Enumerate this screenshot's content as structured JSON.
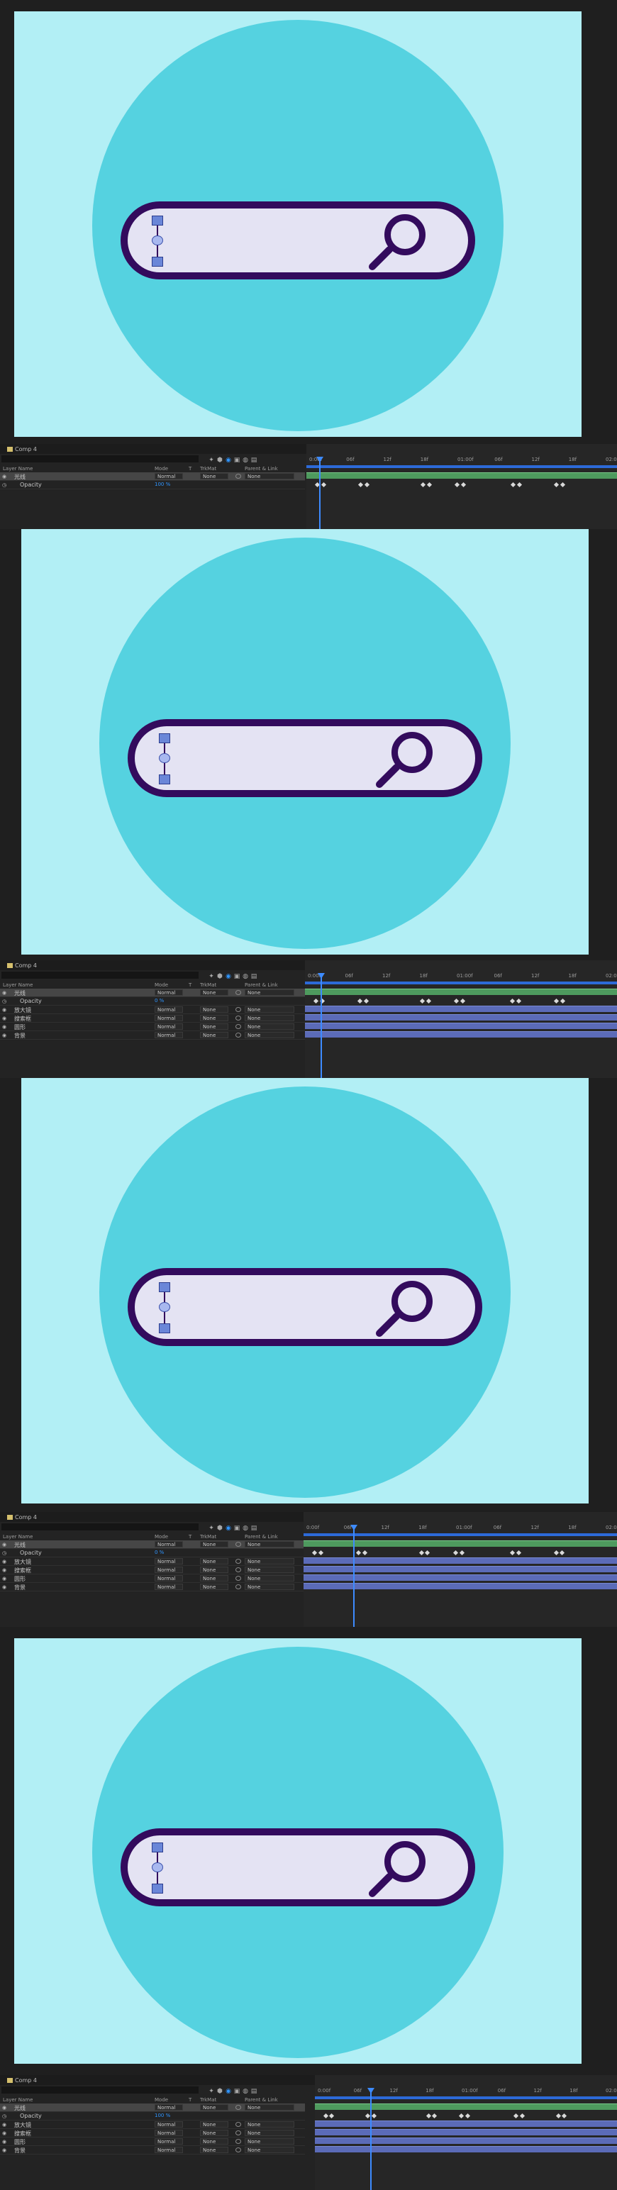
{
  "comp_tab": "Comp 4",
  "header": {
    "layer_name": "Layer Name",
    "mode": "Mode",
    "t": "T",
    "trkmat": "TrkMat",
    "parent": "Parent & Link"
  },
  "ruler_ticks": [
    "0:00f",
    "06f",
    "12f",
    "18f",
    "01:00f",
    "06f",
    "12f",
    "18f",
    "02:0"
  ],
  "frames": [
    {
      "layers": [
        {
          "name": "光线",
          "mode": "Normal",
          "track": "None",
          "parent": "None",
          "selected": true
        },
        {
          "name": "Opacity",
          "value": "100 %",
          "prop": true
        }
      ]
    },
    {
      "layers": [
        {
          "name": "光线",
          "mode": "Normal",
          "track": "None",
          "parent": "None",
          "selected": true
        },
        {
          "name": "Opacity",
          "value": "0 %",
          "prop": true
        },
        {
          "name": "放大镜",
          "mode": "Normal",
          "track": "None",
          "parent": "None"
        },
        {
          "name": "搜索框",
          "mode": "Normal",
          "track": "None",
          "parent": "None"
        },
        {
          "name": "圆形",
          "mode": "Normal",
          "track": "None",
          "parent": "None"
        },
        {
          "name": "背景",
          "mode": "Normal",
          "track": "None",
          "parent": "None"
        }
      ]
    },
    {
      "layers": [
        {
          "name": "光线",
          "mode": "Normal",
          "track": "None",
          "parent": "None",
          "selected": true
        },
        {
          "name": "Opacity",
          "value": "0 %",
          "prop": true
        },
        {
          "name": "放大镜",
          "mode": "Normal",
          "track": "None",
          "parent": "None"
        },
        {
          "name": "搜索框",
          "mode": "Normal",
          "track": "None",
          "parent": "None"
        },
        {
          "name": "圆形",
          "mode": "Normal",
          "track": "None",
          "parent": "None"
        },
        {
          "name": "背景",
          "mode": "Normal",
          "track": "None",
          "parent": "None"
        }
      ]
    },
    {
      "layers": [
        {
          "name": "光线",
          "mode": "Normal",
          "track": "None",
          "parent": "None",
          "selected": true
        },
        {
          "name": "Opacity",
          "value": "100 %",
          "prop": true
        },
        {
          "name": "放大镜",
          "mode": "Normal",
          "track": "None",
          "parent": "None"
        },
        {
          "name": "搜索框",
          "mode": "Normal",
          "track": "None",
          "parent": "None"
        },
        {
          "name": "圆形",
          "mode": "Normal",
          "track": "None",
          "parent": "None"
        },
        {
          "name": "背景",
          "mode": "Normal",
          "track": "None",
          "parent": "None"
        }
      ]
    }
  ],
  "colors": {
    "comp_bg": "#b2eff5",
    "circle": "#55d2e0",
    "searchbox_fill": "#e4e3f3",
    "outline": "#330b5d",
    "accent": "#2f95ff"
  }
}
